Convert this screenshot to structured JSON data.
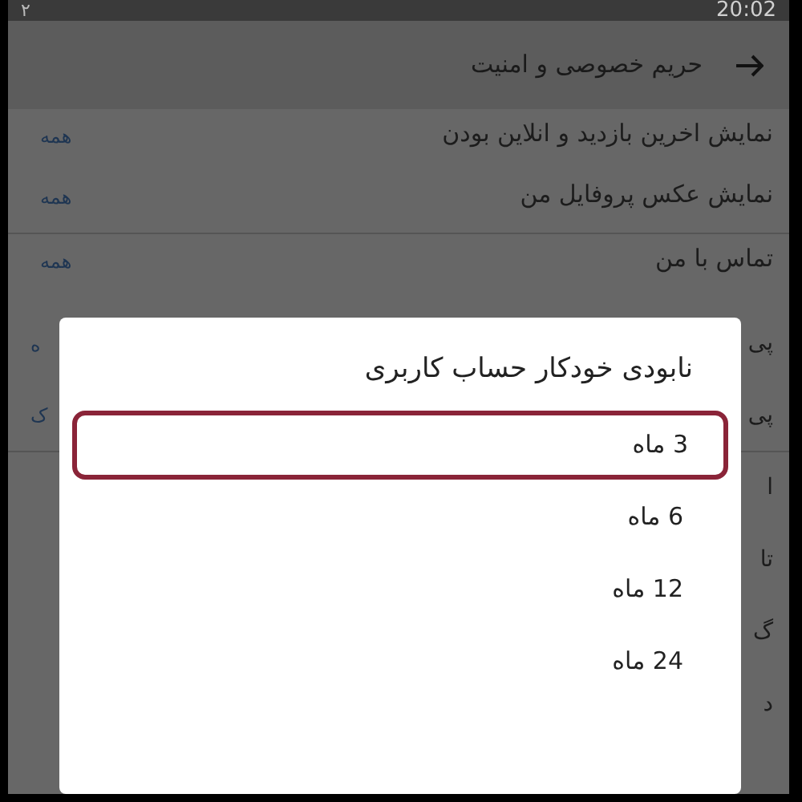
{
  "status_bar": {
    "left_text": "۲",
    "time": "20:02"
  },
  "header": {
    "title": "حریم خصوصی و امنیت"
  },
  "settings": [
    {
      "label": "نمایش اخرین بازدید و انلاین بودن",
      "value": "همه"
    },
    {
      "label": "نمایش عکس پروفایل من",
      "value": "همه"
    },
    {
      "label": "تماس با من",
      "value": "همه"
    }
  ],
  "covered_rows": [
    {
      "text": "پی",
      "value": "ه"
    },
    {
      "text": "پی",
      "value": "ک"
    },
    {
      "text": "ا"
    },
    {
      "text": "تا"
    },
    {
      "text": "گ"
    },
    {
      "text": "د"
    }
  ],
  "dialog": {
    "title": "نابودی خودکار حساب کاربری",
    "options": [
      {
        "label": "3 ماه",
        "selected": true
      },
      {
        "label": "6 ماه",
        "selected": false
      },
      {
        "label": "12 ماه",
        "selected": false
      },
      {
        "label": "24 ماه",
        "selected": false
      }
    ]
  }
}
